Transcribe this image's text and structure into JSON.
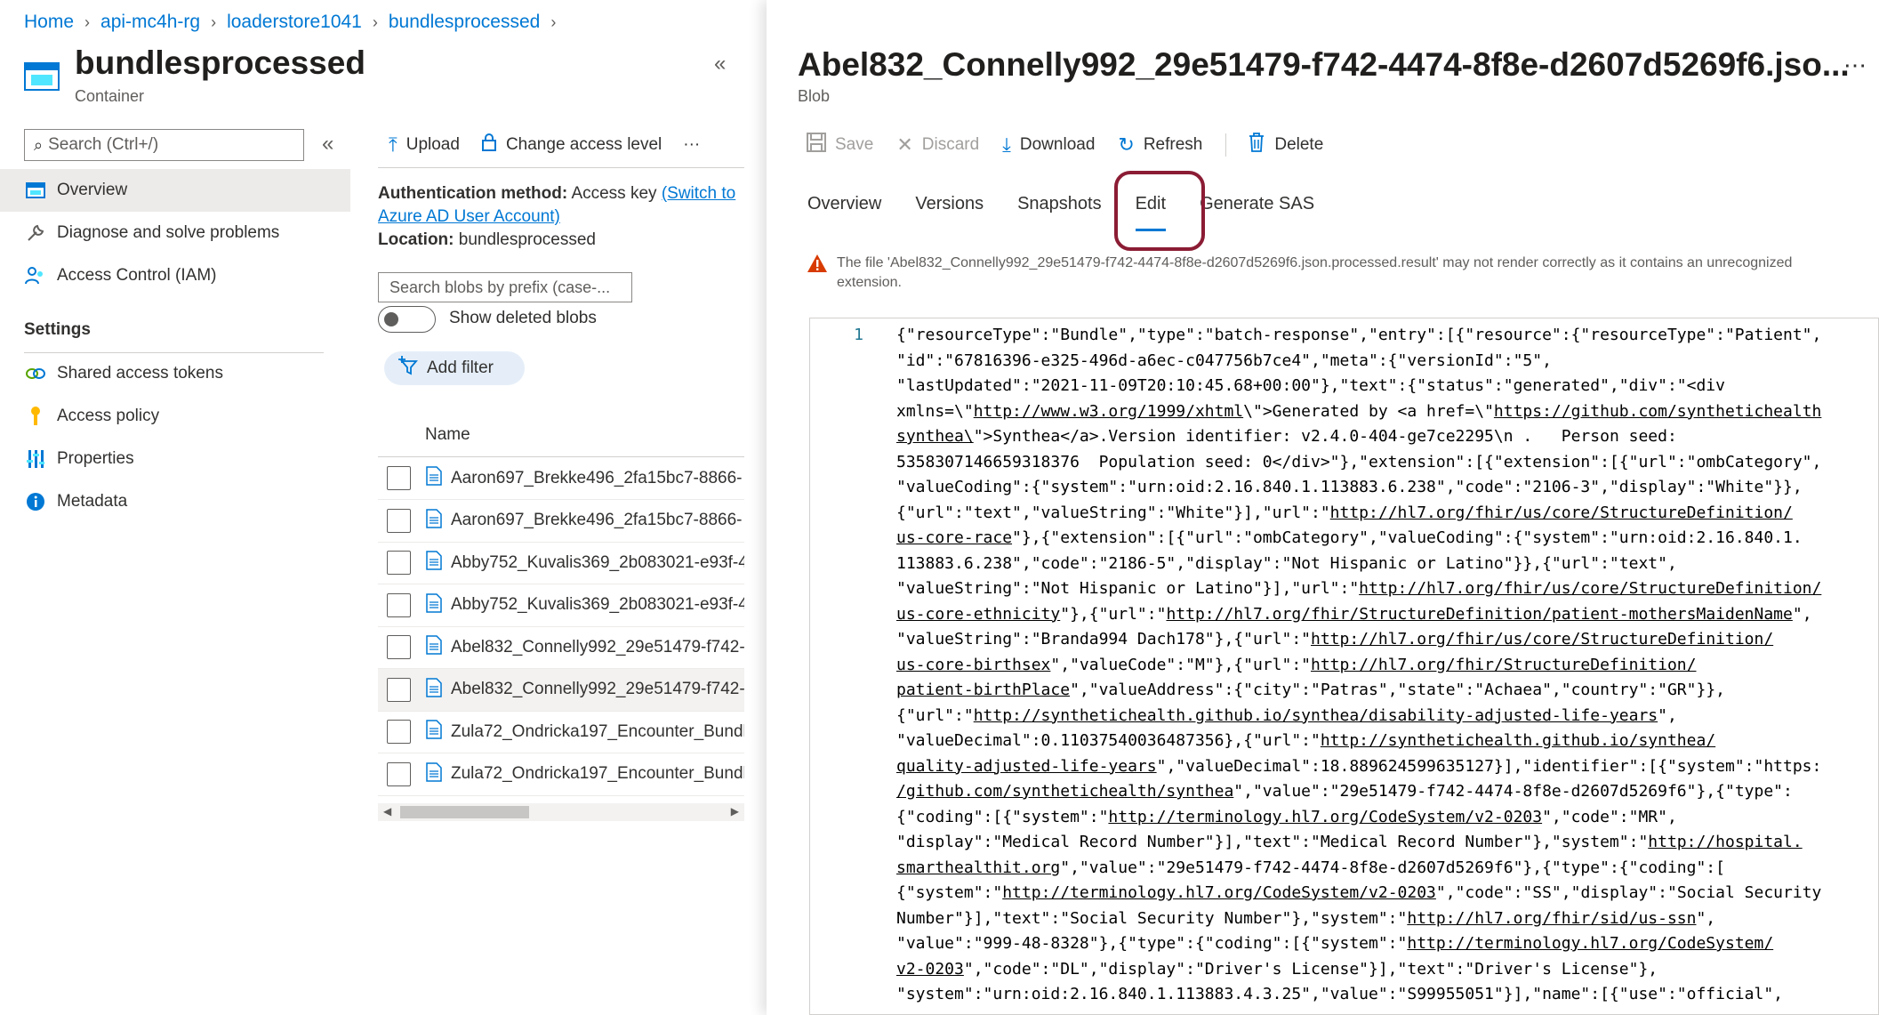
{
  "breadcrumb": [
    "Home",
    "api-mc4h-rg",
    "loaderstore1041",
    "bundlesprocessed"
  ],
  "container": {
    "title": "bundlesprocessed",
    "subtitle": "Container"
  },
  "sidebar": {
    "search_placeholder": "Search (Ctrl+/)",
    "items": [
      {
        "label": "Overview",
        "icon": "overview-icon"
      },
      {
        "label": "Diagnose and solve problems",
        "icon": "wrench-icon"
      },
      {
        "label": "Access Control (IAM)",
        "icon": "people-icon"
      }
    ],
    "settings_header": "Settings",
    "settings_items": [
      {
        "label": "Shared access tokens",
        "icon": "link-icon"
      },
      {
        "label": "Access policy",
        "icon": "key-icon"
      },
      {
        "label": "Properties",
        "icon": "properties-icon"
      },
      {
        "label": "Metadata",
        "icon": "info-icon"
      }
    ]
  },
  "middle": {
    "toolbar": {
      "upload": "Upload",
      "change_access": "Change access level",
      "more": "···"
    },
    "auth_label": "Authentication method:",
    "auth_value": "Access key",
    "auth_switch": "(Switch to Azure AD User Account)",
    "location_label": "Location:",
    "location_value": "bundlesprocessed",
    "blob_search_placeholder": "Search blobs by prefix (case-...",
    "show_deleted": "Show deleted blobs",
    "add_filter": "Add filter",
    "column_name": "Name",
    "blobs": [
      "Aaron697_Brekke496_2fa15bc7-8866-",
      "Aaron697_Brekke496_2fa15bc7-8866-",
      "Abby752_Kuvalis369_2b083021-e93f-4",
      "Abby752_Kuvalis369_2b083021-e93f-4",
      "Abel832_Connelly992_29e51479-f742-",
      "Abel832_Connelly992_29e51479-f742-",
      "Zula72_Ondricka197_Encounter_Bundl",
      "Zula72_Ondricka197_Encounter_Bundl"
    ],
    "selected_index": 5
  },
  "blob": {
    "title": "Abel832_Connelly992_29e51479-f742-4474-8f8e-d2607d5269f6.jso...",
    "subtitle": "Blob",
    "toolbar": {
      "save": "Save",
      "discard": "Discard",
      "download": "Download",
      "refresh": "Refresh",
      "delete": "Delete"
    },
    "tabs": [
      "Overview",
      "Versions",
      "Snapshots",
      "Edit",
      "Generate SAS"
    ],
    "active_tab": "Edit",
    "warning": "The file 'Abel832_Connelly992_29e51479-f742-4474-8f8e-d2607d5269f6.json.processed.result' may not render correctly as it contains an unrecognized extension.",
    "line_number": "1",
    "code_lines": [
      "{\"resourceType\":\"Bundle\",\"type\":\"batch-response\",\"entry\":[{\"resource\":{\"resourceType\":\"Patient\",",
      "\"id\":\"67816396-e325-496d-a6ec-c047756b7ce4\",\"meta\":{\"versionId\":\"5\",",
      "\"lastUpdated\":\"2021-11-09T20:10:45.68+00:00\"},\"text\":{\"status\":\"generated\",\"div\":\"<div",
      "xmlns=\\\"http://www.w3.org/1999/xhtml\\\">Generated by <a href=\\\"https://github.com/synthetichealth",
      "synthea\\\">Synthea</a>.Version identifier: v2.4.0-404-ge7ce2295\\n .   Person seed:",
      "5358307146659318376  Population seed: 0</div>\"},\"extension\":[{\"extension\":[{\"url\":\"ombCategory\",",
      "\"valueCoding\":{\"system\":\"urn:oid:2.16.840.1.113883.6.238\",\"code\":\"2106-3\",\"display\":\"White\"}},",
      "{\"url\":\"text\",\"valueString\":\"White\"}],\"url\":\"http://hl7.org/fhir/us/core/StructureDefinition/",
      "us-core-race\"},{\"extension\":[{\"url\":\"ombCategory\",\"valueCoding\":{\"system\":\"urn:oid:2.16.840.1.",
      "113883.6.238\",\"code\":\"2186-5\",\"display\":\"Not Hispanic or Latino\"}},{\"url\":\"text\",",
      "\"valueString\":\"Not Hispanic or Latino\"}],\"url\":\"http://hl7.org/fhir/us/core/StructureDefinition/",
      "us-core-ethnicity\"},{\"url\":\"http://hl7.org/fhir/StructureDefinition/patient-mothersMaidenName\",",
      "\"valueString\":\"Branda994 Dach178\"},{\"url\":\"http://hl7.org/fhir/us/core/StructureDefinition/",
      "us-core-birthsex\",\"valueCode\":\"M\"},{\"url\":\"http://hl7.org/fhir/StructureDefinition/",
      "patient-birthPlace\",\"valueAddress\":{\"city\":\"Patras\",\"state\":\"Achaea\",\"country\":\"GR\"}},",
      "{\"url\":\"http://synthetichealth.github.io/synthea/disability-adjusted-life-years\",",
      "\"valueDecimal\":0.11037540036487356},{\"url\":\"http://synthetichealth.github.io/synthea/",
      "quality-adjusted-life-years\",\"valueDecimal\":18.889624599635127}],\"identifier\":[{\"system\":\"https:",
      "/github.com/synthetichealth/synthea\",\"value\":\"29e51479-f742-4474-8f8e-d2607d5269f6\"},{\"type\":",
      "{\"coding\":[{\"system\":\"http://terminology.hl7.org/CodeSystem/v2-0203\",\"code\":\"MR\",",
      "\"display\":\"Medical Record Number\"}],\"text\":\"Medical Record Number\"},\"system\":\"http://hospital.",
      "smarthealthit.org\",\"value\":\"29e51479-f742-4474-8f8e-d2607d5269f6\"},{\"type\":{\"coding\":[",
      "{\"system\":\"http://terminology.hl7.org/CodeSystem/v2-0203\",\"code\":\"SS\",\"display\":\"Social Security",
      "Number\"}],\"text\":\"Social Security Number\"},\"system\":\"http://hl7.org/fhir/sid/us-ssn\",",
      "\"value\":\"999-48-8328\"},{\"type\":{\"coding\":[{\"system\":\"http://terminology.hl7.org/CodeSystem/",
      "v2-0203\",\"code\":\"DL\",\"display\":\"Driver's License\"}],\"text\":\"Driver's License\"},",
      "\"system\":\"urn:oid:2.16.840.1.113883.4.3.25\",\"value\":\"S99955051\"}],\"name\":[{\"use\":\"official\","
    ]
  },
  "colors": {
    "accent": "#0078d4",
    "highlight_ring": "#8b1c34",
    "warning": "#d83b01"
  }
}
